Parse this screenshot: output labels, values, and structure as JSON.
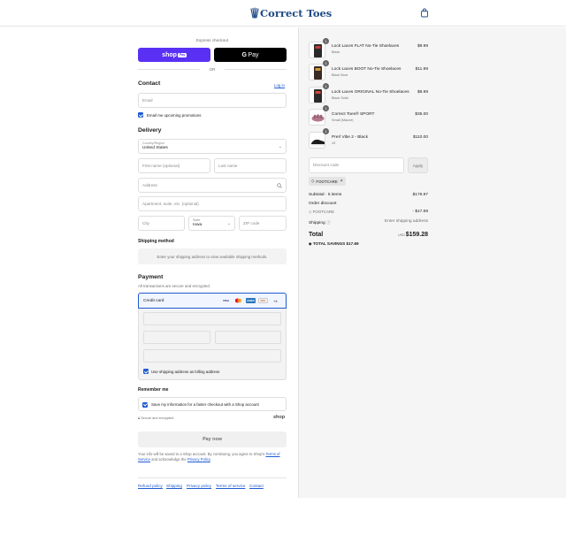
{
  "header": {
    "brand_name": "Correct Toes",
    "cart_icon": "shopping-bag-icon"
  },
  "express": {
    "label": "Express checkout",
    "shop_pay_label": "shop",
    "shop_pay_badge": "Pay",
    "gpay_label": "Pay",
    "or_label": "OR"
  },
  "contact": {
    "title": "Contact",
    "login_label": "Log in",
    "email_placeholder": "Email",
    "email_news_label": "Email me upcoming promotions"
  },
  "delivery": {
    "title": "Delivery",
    "country_label": "Country/Region",
    "country_value": "United States",
    "first_name_placeholder": "First name (optional)",
    "last_name_placeholder": "Last name",
    "address_placeholder": "Address",
    "apartment_placeholder": "Apartment, suite, etc. (optional)",
    "city_placeholder": "City",
    "state_label": "State",
    "state_value": "Iowa",
    "zip_placeholder": "ZIP code"
  },
  "shipping_method": {
    "title": "Shipping method",
    "notice": "Enter your shipping address to view available shipping methods."
  },
  "payment": {
    "title": "Payment",
    "subtitle": "All transactions are secure and encrypted.",
    "credit_card_label": "Credit card",
    "card_brands": [
      "VISA",
      "MC",
      "AMEX",
      "DISC"
    ],
    "more_cards": "+4",
    "billing_label": "Use shipping address as billing address"
  },
  "remember": {
    "title": "Remember me",
    "save_label": "Save my information for a faster checkout with a Shop account",
    "secure_label": "Secure and encrypted",
    "shop_logo": "shop"
  },
  "pay_now_label": "Pay now",
  "disclaimer": {
    "text1": "Your info will be saved to a Shop account. By continuing, you agree to Shop's",
    "terms": "Terms of Service",
    "text2": "and acknowledge the",
    "privacy": "Privacy Policy",
    "text3": "."
  },
  "footer": {
    "links": [
      "Refund policy",
      "Shipping",
      "Privacy policy",
      "Terms of service",
      "Contact"
    ]
  },
  "order": {
    "items": [
      {
        "name": "Lock Laces FLAT No-Tie Shoelaces",
        "variant": "Black",
        "price": "$9.99",
        "qty": "1"
      },
      {
        "name": "Lock Laces BOOT No-Tie Shoelaces",
        "variant": "Black Boot",
        "price": "$11.99",
        "qty": "1"
      },
      {
        "name": "Lock Laces ORIGINAL No-Tie Shoelaces",
        "variant": "Black Solid",
        "price": "$9.99",
        "qty": "1"
      },
      {
        "name": "Correct Toes® SPORT",
        "variant": "Small (Mauve)",
        "price": "$35.00",
        "qty": "1"
      },
      {
        "name": "Prerl Vibe 2 - Black",
        "variant": "10",
        "price": "$110.00",
        "qty": "1"
      }
    ],
    "discount_placeholder": "Discount code",
    "apply_label": "Apply",
    "discount_tag": "FOOTCARE",
    "subtotal_label": "Subtotal · 5 items",
    "subtotal_value": "$176.97",
    "order_discount_label": "Order discount",
    "discount_code": "FOOTCARE",
    "discount_value": "- $17.69",
    "shipping_label": "Shipping",
    "shipping_value": "Enter shipping address",
    "total_label": "Total",
    "currency": "USD",
    "total_value": "$159.28",
    "savings_label": "TOTAL SAVINGS",
    "savings_value": "$17.69"
  },
  "colors": {
    "brand": "#1e4b86",
    "shop_pay": "#5a31f4",
    "link": "#1f5bd1",
    "panel": "#f5f5f5"
  }
}
